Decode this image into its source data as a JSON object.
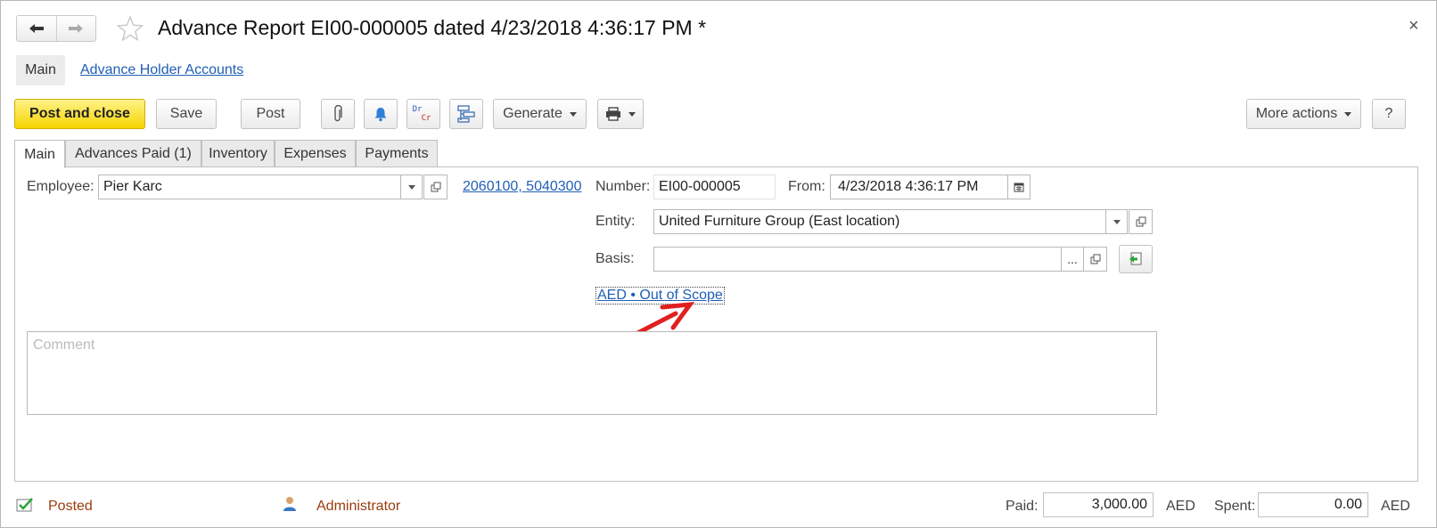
{
  "window": {
    "title": "Advance Report EI00-000005 dated 4/23/2018 4:36:17 PM *",
    "close_label": "×"
  },
  "nav": {
    "main_label": "Main",
    "link_label": "Advance Holder Accounts"
  },
  "toolbar": {
    "post_and_close": "Post and close",
    "save": "Save",
    "post": "Post",
    "dr_label": "Dr",
    "cr_label": "Cr",
    "generate": "Generate",
    "more_actions": "More actions",
    "help": "?"
  },
  "tabs": [
    {
      "label": "Main",
      "active": true
    },
    {
      "label": "Advances Paid (1)",
      "active": false
    },
    {
      "label": "Inventory",
      "active": false
    },
    {
      "label": "Expenses",
      "active": false
    },
    {
      "label": "Payments",
      "active": false
    }
  ],
  "form": {
    "employee_label": "Employee:",
    "employee_value": "Pier Karc",
    "accounts_link": "2060100, 5040300",
    "number_label": "Number:",
    "number_value": "EI00-000005",
    "from_label": "From:",
    "from_value": "4/23/2018  4:36:17 PM",
    "entity_label": "Entity:",
    "entity_value": "United Furniture Group (East location)",
    "basis_label": "Basis:",
    "basis_value": "",
    "basis_ellipsis": "...",
    "tax_link": "AED • Out of Scope",
    "comment_placeholder": "Comment"
  },
  "footer": {
    "posted_label": "Posted",
    "user_label": "Administrator",
    "paid_label": "Paid:",
    "paid_value": "3,000.00",
    "paid_currency": "AED",
    "spent_label": "Spent:",
    "spent_value": "0.00",
    "spent_currency": "AED"
  },
  "colors": {
    "primary_button": "#f5d400",
    "link": "#1f5fb5",
    "status_text": "#9a3c0e",
    "annotation_arrow": "#e02020"
  }
}
